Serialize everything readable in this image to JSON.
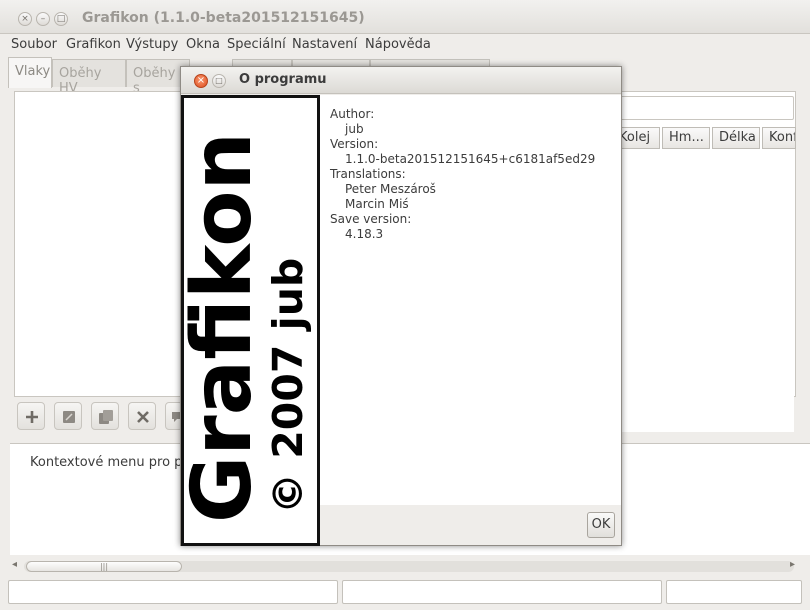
{
  "window": {
    "title": "Grafikon (1.1.0-beta201512151645)",
    "close_glyph": "×",
    "minimize_glyph": "–",
    "maximize_glyph": "□"
  },
  "menu": [
    "Soubor",
    "Grafikon",
    "Výstupy",
    "Okna",
    "Speciální",
    "Nastavení",
    "Nápověda"
  ],
  "tabs": {
    "items": [
      "Vlaky",
      "Oběhy HV",
      "Oběhy s"
    ],
    "active_index": 0
  },
  "columns": [
    "Kolej",
    "Hm...",
    "Délka",
    "Konf"
  ],
  "context_text": "Kontextové menu pro p",
  "scrollbar": {
    "thumb_grip": "|||",
    "left_arrow": "◂",
    "right_arrow": "▸"
  },
  "dialog": {
    "title": "O programu",
    "close_glyph": "×",
    "maximize_glyph": "□",
    "logo": {
      "main_text": "Grafikon",
      "copyright_text": "© 2007 jub"
    },
    "info": {
      "author_label": "Author:",
      "author_value": "jub",
      "version_label": "Version:",
      "version_value": "1.1.0-beta201512151645+c6181af5ed29",
      "translations_label": "Translations:",
      "translators": [
        "Peter Meszároš",
        "Marcin Miś"
      ],
      "save_version_label": "Save version:",
      "save_version_value": "4.18.3"
    },
    "ok_label": "OK"
  },
  "colors": {
    "close_button": "#de4c1c",
    "logo_text": "#000000",
    "logo_background": "#ffffff"
  }
}
